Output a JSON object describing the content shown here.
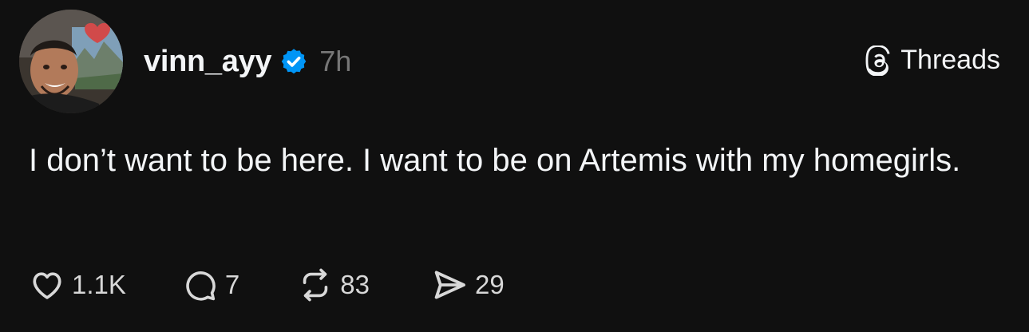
{
  "post": {
    "author": {
      "username": "vinn_ayy",
      "verified": true,
      "avatar_icon": "profile-photo"
    },
    "timestamp": "7h",
    "brand": {
      "label": "Threads",
      "icon": "threads-logo-icon"
    },
    "text": "I don’t want to be here. I want to be on Artemis with my homegirls.",
    "actions": {
      "likes": "1.1K",
      "replies": "7",
      "reposts": "83",
      "shares": "29"
    }
  },
  "colors": {
    "background": "#101010",
    "text": "#f3f5f7",
    "muted": "#777777",
    "verified_badge": "#0095f6"
  }
}
